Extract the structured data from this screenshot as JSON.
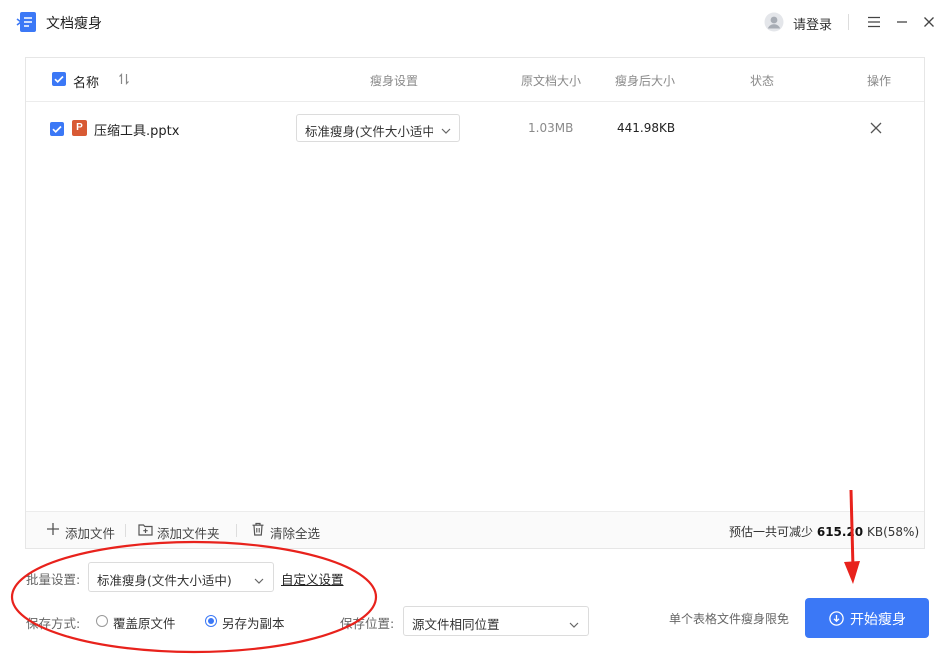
{
  "app": {
    "title": "文档瘦身",
    "login": "请登录"
  },
  "colors": {
    "accent": "#3b78f6",
    "annotation": "#e8221c",
    "ppt": "#d85a34"
  },
  "table": {
    "headers": {
      "name": "名称",
      "setting": "瘦身设置",
      "original_size": "原文档大小",
      "new_size": "瘦身后大小",
      "status": "状态",
      "action": "操作"
    },
    "rows": [
      {
        "icon_letter": "P",
        "name": "压缩工具.pptx",
        "setting": "标准瘦身(文件大小适中)",
        "original_size": "1.03MB",
        "new_size": "441.98KB",
        "status": "",
        "checked": true
      }
    ]
  },
  "toolbar": {
    "add_file": "添加文件",
    "add_folder": "添加文件夹",
    "clear_all": "清除全选",
    "estimate_prefix": "预估一共可减少",
    "estimate_value": "615.20",
    "estimate_suffix": "KB(58%)"
  },
  "settings": {
    "batch_label": "批量设置:",
    "batch_value": "标准瘦身(文件大小适中)",
    "custom_link": "自定义设置",
    "save_mode_label": "保存方式:",
    "overwrite": "覆盖原文件",
    "save_copy": "另存为副本",
    "save_location_label": "保存位置:",
    "save_location_value": "源文件相同位置",
    "selected_mode": "save_copy"
  },
  "footer": {
    "free_note": "单个表格文件瘦身限免",
    "start_button": "开始瘦身"
  }
}
